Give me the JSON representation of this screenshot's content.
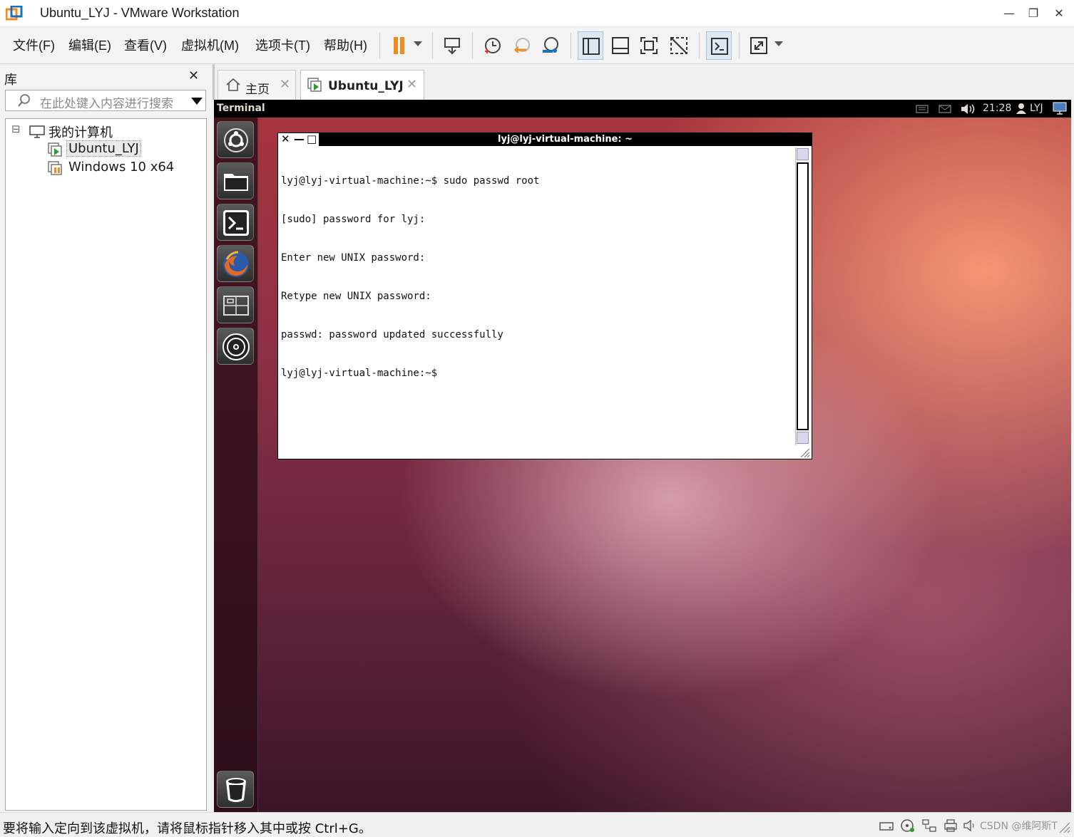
{
  "window": {
    "title": "Ubuntu_LYJ - VMware Workstation",
    "minimize": "—",
    "maximize": "❐",
    "close": "✕"
  },
  "menu": {
    "items": [
      "文件(F)",
      "编辑(E)",
      "查看(V)",
      "虚拟机(M)",
      "选项卡(T)",
      "帮助(H)"
    ]
  },
  "library": {
    "title": "库",
    "close": "✕",
    "search_placeholder": "在此处键入内容进行搜索",
    "tree": {
      "root": "我的计算机",
      "root_toggle": "⊟",
      "vms": [
        "Ubuntu_LYJ",
        "Windows 10 x64"
      ]
    }
  },
  "tabs": [
    {
      "label": "主页",
      "close": "✕"
    },
    {
      "label": "Ubuntu_LYJ",
      "close": "✕"
    }
  ],
  "guest": {
    "topbar": {
      "app_name": "Terminal",
      "time": "21:28",
      "user": "LYJ"
    },
    "terminal": {
      "title": "lyj@lyj-virtual-machine: ~",
      "close": "✕",
      "minimize": "—",
      "maximize": "□",
      "lines": [
        "lyj@lyj-virtual-machine:~$ sudo passwd root",
        "[sudo] password for lyj:",
        "Enter new UNIX password:",
        "Retype new UNIX password:",
        "passwd: password updated successfully",
        "lyj@lyj-virtual-machine:~$"
      ]
    }
  },
  "status": {
    "text": "要将输入定向到该虚拟机，请将鼠标指针移入其中或按 Ctrl+G。",
    "watermark": "CSDN @维阿斯T"
  },
  "colors": {
    "pause_orange": "#f08c1e",
    "toolbar_blue": "#1f6fb5",
    "ubuntu_orange": "#dd4814"
  }
}
